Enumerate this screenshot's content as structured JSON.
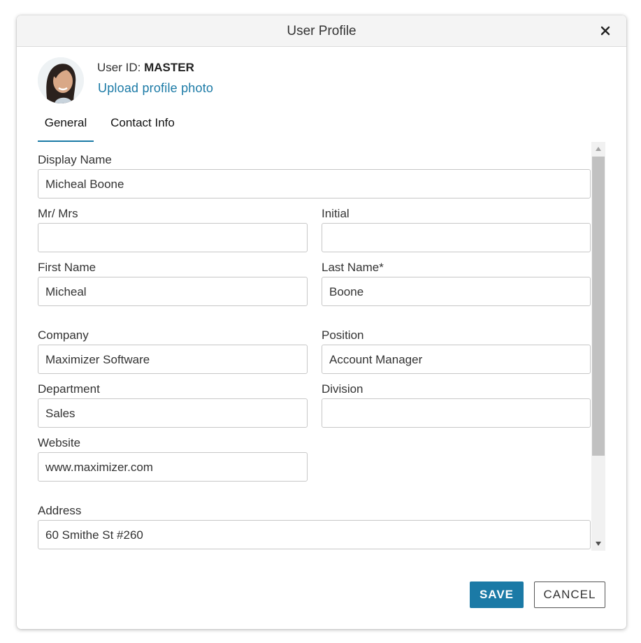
{
  "dialog": {
    "title": "User Profile",
    "close_icon": "close-icon"
  },
  "user": {
    "id_label": "User ID:",
    "id_value": "MASTER",
    "upload_link": "Upload profile photo",
    "avatar_icon": "profile-photo"
  },
  "tabs": [
    {
      "label": "General",
      "active": true
    },
    {
      "label": "Contact Info",
      "active": false
    }
  ],
  "form": {
    "display_name": {
      "label": "Display Name",
      "value": "Micheal Boone"
    },
    "salutation": {
      "label": "Mr/ Mrs",
      "value": ""
    },
    "initial": {
      "label": "Initial",
      "value": ""
    },
    "first_name": {
      "label": "First Name",
      "value": "Micheal"
    },
    "last_name": {
      "label": "Last Name*",
      "value": "Boone"
    },
    "company": {
      "label": "Company",
      "value": "Maximizer Software"
    },
    "position": {
      "label": "Position",
      "value": "Account Manager"
    },
    "department": {
      "label": "Department",
      "value": "Sales"
    },
    "division": {
      "label": "Division",
      "value": ""
    },
    "website": {
      "label": "Website",
      "value": "www.maximizer.com"
    },
    "address": {
      "label": "Address",
      "value": "60 Smithe St #260"
    }
  },
  "buttons": {
    "save": "SAVE",
    "cancel": "CANCEL"
  },
  "colors": {
    "accent": "#1b7aa6",
    "titlebar": "#f4f4f4",
    "field_border": "#c7c7c7"
  }
}
